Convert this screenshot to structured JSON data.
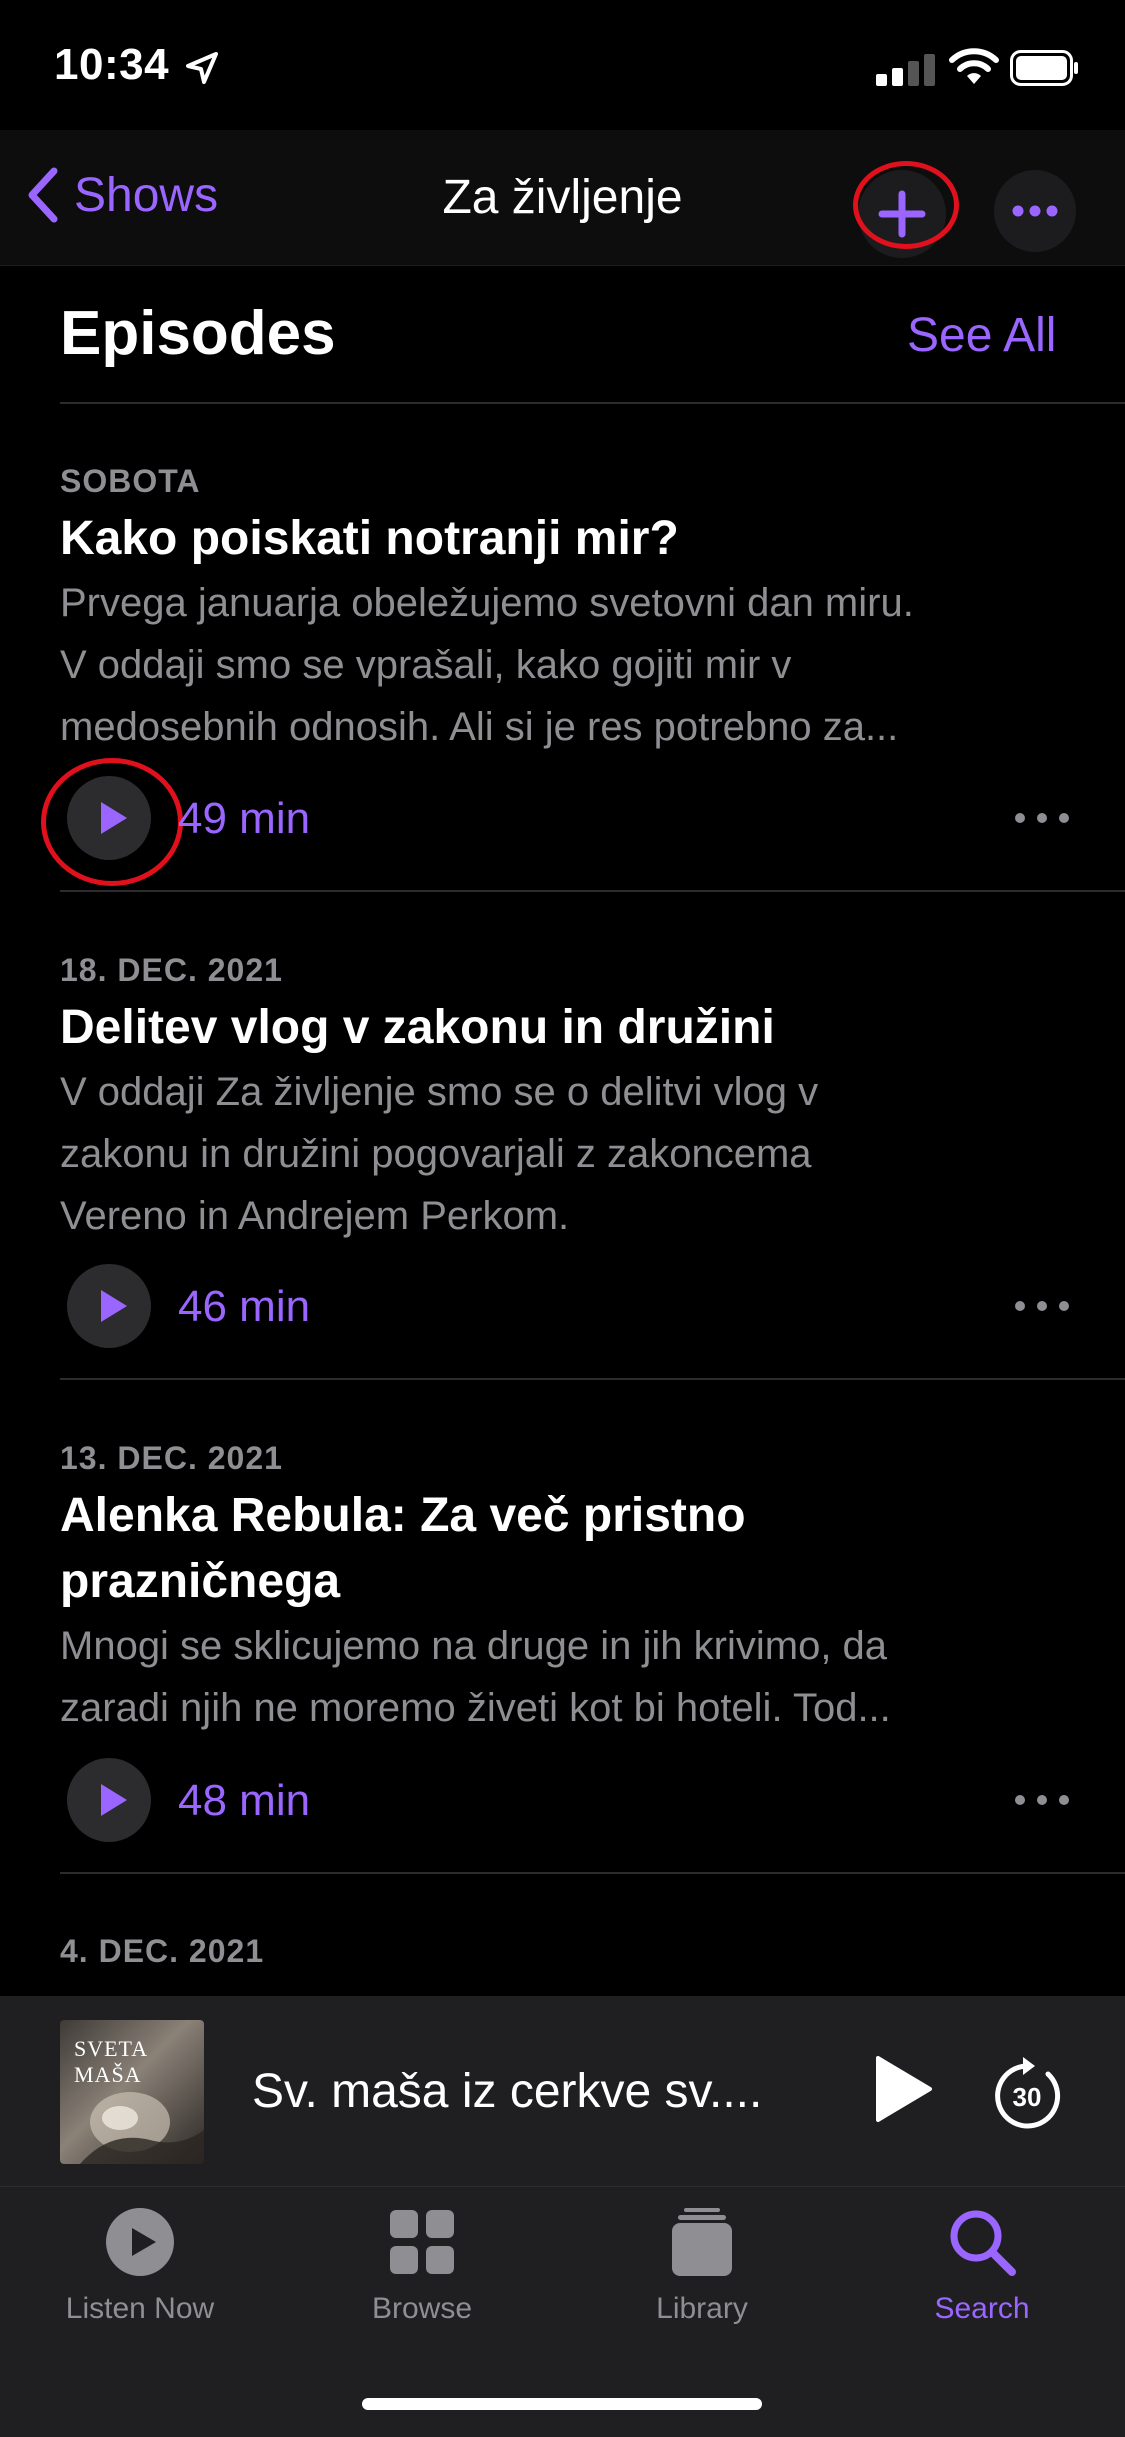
{
  "status_bar": {
    "time": "10:34"
  },
  "nav": {
    "back_label": "Shows",
    "title": "Za življenje"
  },
  "section": {
    "title": "Episodes",
    "see_all": "See All"
  },
  "episodes": [
    {
      "date": "SOBOTA",
      "title": "Kako poiskati notranji mir?",
      "description_lines": [
        "Prvega januarja obeležujemo svetovni dan miru.",
        "V oddaji smo se vprašali, kako gojiti mir v",
        "medosebnih odnosih. Ali si je res potrebno za..."
      ],
      "duration": "49 min"
    },
    {
      "date": "18. DEC. 2021",
      "title": "Delitev vlog v zakonu in družini",
      "description_lines": [
        "V oddaji Za življenje smo se o delitvi vlog v",
        "zakonu in družini pogovarjali z zakoncema",
        "Vereno in Andrejem Perkom."
      ],
      "duration": "46 min"
    },
    {
      "date": "13. DEC. 2021",
      "title_lines": [
        "Alenka Rebula: Za več pristno",
        "prazničnega"
      ],
      "description_lines": [
        "Mnogi se sklicujemo na druge in jih krivimo, da",
        "zaradi njih ne moremo živeti kot bi hoteli. Tod..."
      ],
      "duration": "48 min"
    },
    {
      "date": "4. DEC. 2021"
    }
  ],
  "mini_player": {
    "artwork_text": "SVETA MAŠA",
    "title": "Sv. maša iz cerkve sv....",
    "skip_label": "30"
  },
  "tabs": [
    {
      "label": "Listen Now",
      "icon": "play-circle-icon",
      "active": false
    },
    {
      "label": "Browse",
      "icon": "grid-icon",
      "active": false
    },
    {
      "label": "Library",
      "icon": "stack-icon",
      "active": false
    },
    {
      "label": "Search",
      "icon": "magnifier-icon",
      "active": true
    }
  ],
  "colors": {
    "accent": "#9a66ff",
    "highlight_ring": "#e0101c",
    "secondary_text": "#8e8e93"
  }
}
